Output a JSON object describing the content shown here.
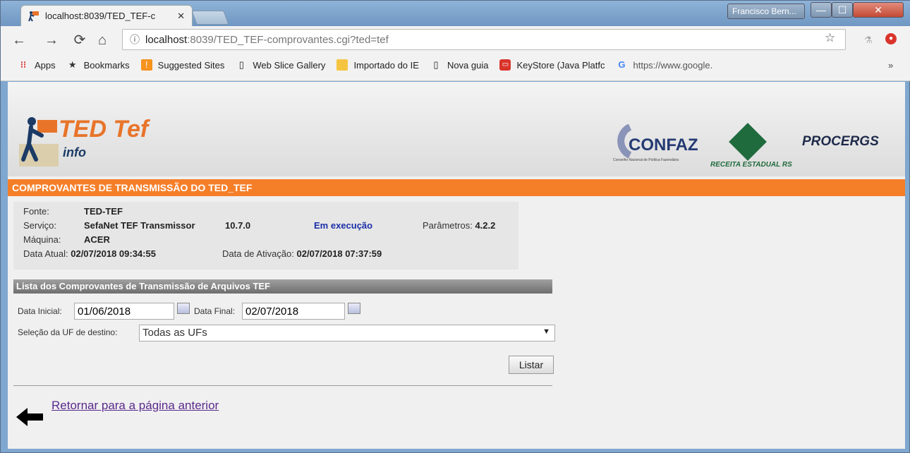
{
  "window": {
    "tab_title": "localhost:8039/TED_TEF-c",
    "user_name": "Francisco Bern..."
  },
  "toolbar": {
    "url_host": "localhost",
    "url_path": ":8039/TED_TEF-comprovantes.cgi?ted=tef",
    "bookmarks": [
      {
        "label": "Apps",
        "icon": "apps-grid-icon"
      },
      {
        "label": "Bookmarks",
        "icon": "star-icon"
      },
      {
        "label": "Suggested Sites",
        "icon": "suggested-sites-icon"
      },
      {
        "label": "Web Slice Gallery",
        "icon": "page-icon"
      },
      {
        "label": "Importado do IE",
        "icon": "folder-icon"
      },
      {
        "label": "Nova guia",
        "icon": "page-icon"
      },
      {
        "label": "KeyStore (Java Platfc",
        "icon": "java-icon"
      },
      {
        "label": "https://www.google.",
        "icon": "google-icon"
      }
    ],
    "more_label": "»"
  },
  "banner": {
    "app_name": "TED Tef",
    "app_sub": "info",
    "confaz": "CONFAZ",
    "confaz_sub": "Conselho Nacional de Política Fazendária",
    "receita": "RECEITA ESTADUAL RS",
    "procergs": "PROCERGS"
  },
  "page": {
    "title": "COMPROVANTES DE TRANSMISSÃO DO TED_TEF",
    "info": {
      "fonte_label": "Fonte:",
      "fonte_value": "TED-TEF",
      "servico_label": "Serviço:",
      "servico_value": "SefaNet TEF Transmissor",
      "version": "10.7.0",
      "status": "Em execução",
      "parametros_label": "Parâmetros:",
      "parametros_value": "4.2.2",
      "maquina_label": "Máquina:",
      "maquina_value": "ACER",
      "data_atual_label": "Data Atual:",
      "data_atual_value": "02/07/2018 09:34:55",
      "data_ativacao_label": "Data de Ativação:",
      "data_ativacao_value": "02/07/2018 07:37:59"
    },
    "section_title": "Lista dos Comprovantes de Transmissão de Arquivos TEF",
    "filters": {
      "data_inicial_label": "Data Inicial:",
      "data_inicial_value": "01/06/2018",
      "data_final_label": "Data Final:",
      "data_final_value": "02/07/2018",
      "uf_label": "Seleção da UF de destino:",
      "uf_value": "Todas as UFs"
    },
    "listar_label": "Listar",
    "back_link": "Retornar para a página anterior"
  }
}
